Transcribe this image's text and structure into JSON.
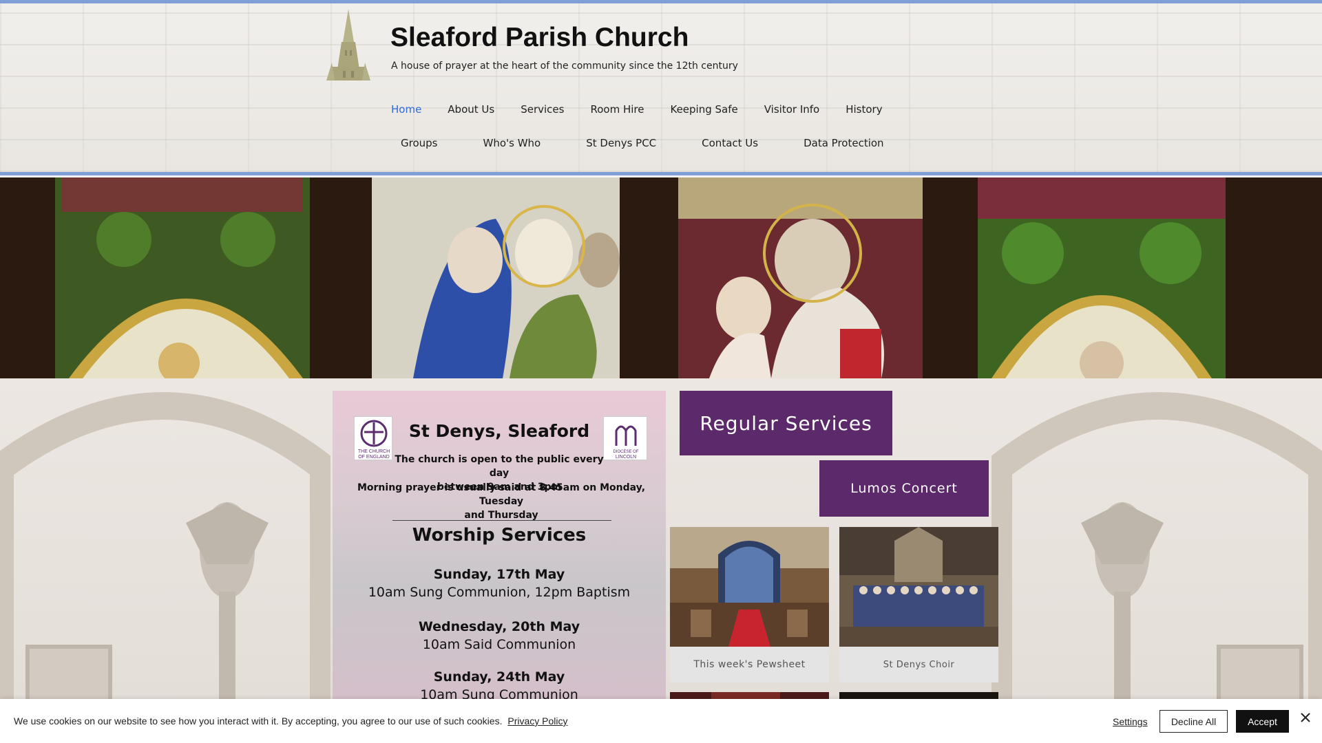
{
  "header": {
    "title": "Sleaford Parish Church",
    "tagline": "A house of prayer at the heart of the community since the 12th century"
  },
  "nav": {
    "row1": [
      "Home",
      "About Us",
      "Services",
      "Room Hire",
      "Keeping Safe",
      "Visitor Info",
      "History"
    ],
    "row2": [
      "Groups",
      "Who's Who",
      "St Denys PCC",
      "Contact Us",
      "Data Protection"
    ],
    "active": "Home"
  },
  "flyer": {
    "title": "St Denys, Sleaford",
    "open_line1": "The church is open to the public every day",
    "open_line2": "between 9am and 3pm",
    "prayer_line1": "Morning prayer is usually said at 8.45am on Monday, Tuesday",
    "prayer_line2": "and Thursday",
    "worship_heading": "Worship Services",
    "services": [
      {
        "day": "Sunday, 17th May",
        "desc": "10am Sung Communion, 12pm Baptism"
      },
      {
        "day": "Wednesday,  20th May",
        "desc": "10am Said Communion"
      },
      {
        "day": "Sunday, 24th May",
        "desc": "10am Sung Communion"
      }
    ],
    "coe_logo_text_1": "THE CHURCH",
    "coe_logo_text_2": "OF ENGLAND",
    "diocese_logo_text_1": "DIOCESE OF",
    "diocese_logo_text_2": "LINCOLN"
  },
  "buttons": {
    "regular_services": "Regular Services",
    "lumos_concert": "Lumos Concert"
  },
  "gallery": [
    {
      "caption": "This week's Pewsheet",
      "icon": "church-interior-photo"
    },
    {
      "caption": "St Denys Choir",
      "icon": "choir-photo"
    }
  ],
  "cookie": {
    "text": "We use cookies on our website to see how you interact with it. By accepting, you agree to our use of such cookies.",
    "privacy_link": "Privacy Policy",
    "settings": "Settings",
    "decline": "Decline All",
    "accept": "Accept"
  },
  "colors": {
    "accent_blue": "#7ea0d6",
    "nav_active": "#2f6bd6",
    "button_purple": "#5c2a6a"
  }
}
